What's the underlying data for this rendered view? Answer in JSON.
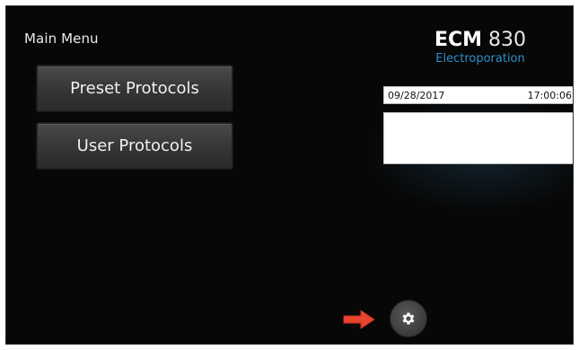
{
  "main_menu": {
    "title": "Main Menu",
    "buttons": [
      {
        "label": "Preset Protocols"
      },
      {
        "label": "User Protocols"
      }
    ]
  },
  "device": {
    "model": "ECM",
    "model_number": "830",
    "subtitle": "Electroporation"
  },
  "status": {
    "date": "09/28/2017",
    "time": "17:00:06"
  },
  "controls": {
    "settings_icon": "gear-icon",
    "pointer_icon": "arrow-right-icon"
  },
  "colors": {
    "background": "#070707",
    "accent_blue": "#2e8fc7",
    "arrow_red": "#e8452e"
  }
}
